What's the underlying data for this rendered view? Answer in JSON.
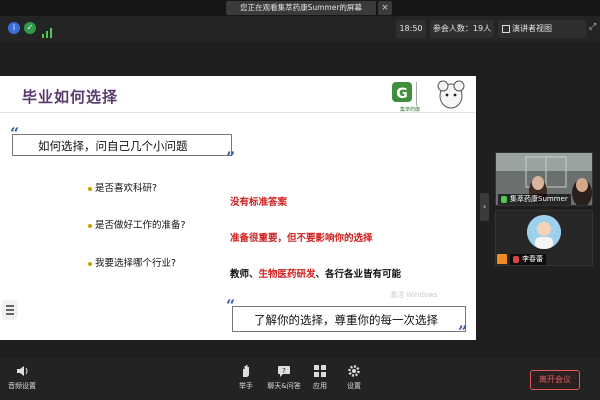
{
  "banner": {
    "text": "您正在观看集萃药康Summer的屏幕",
    "close": "×"
  },
  "topbar": {
    "time": "18:50",
    "participants": "参会人数：19人",
    "view_label": "演讲者视图"
  },
  "slide": {
    "title": "毕业如何选择",
    "logo_text": "集萃药康",
    "quote1": "如何选择，问自己几个小问题",
    "questions": [
      {
        "q": "是否喜欢科研?",
        "a_parts": [
          {
            "text": "没有标准答案",
            "color": "red"
          }
        ]
      },
      {
        "q": "是否做好工作的准备?",
        "a_parts": [
          {
            "text": "准备很重要，但不要影响你的选择",
            "color": "red"
          }
        ]
      },
      {
        "q": "我要选择哪个行业?",
        "a_parts": [
          {
            "text": "教师、",
            "color": "black"
          },
          {
            "text": "生物医药研发",
            "color": "red"
          },
          {
            "text": "、各行各业皆有可能",
            "color": "black"
          }
        ]
      }
    ],
    "quote2": "了解你的选择，尊重你的每一次选择",
    "watermark": "激活 Windows"
  },
  "participants": [
    {
      "name": "集萃药康Summer",
      "mic": "on"
    },
    {
      "name": "李春蕾",
      "mic": "muted"
    }
  ],
  "bottombar": {
    "audio": "音频设置",
    "raise_hand": "举手",
    "chat": "聊天&问答",
    "apps": "应用",
    "settings": "设置",
    "leave": "离开会议"
  },
  "colors": {
    "title": "#5a3a6e",
    "quote_mark": "#3b5aa8",
    "answer_red": "#d02020",
    "leave": "#e05a5a"
  }
}
